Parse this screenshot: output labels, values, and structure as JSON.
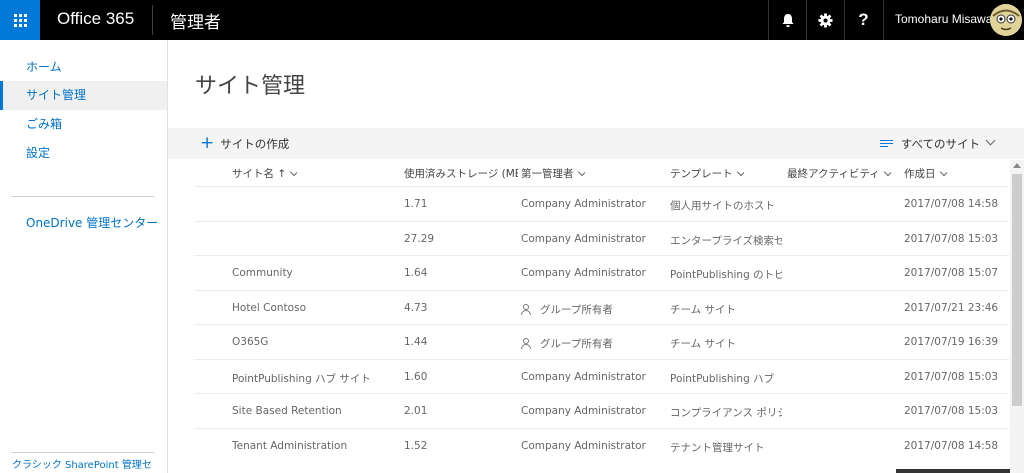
{
  "header": {
    "brand": "Office 365",
    "app_name": "管理者",
    "help_label": "?",
    "user_name": "Tomoharu Misawa"
  },
  "nav": {
    "items": [
      {
        "label": "ホーム"
      },
      {
        "label": "サイト管理"
      },
      {
        "label": "ごみ箱"
      },
      {
        "label": "設定"
      }
    ],
    "onedrive": "OneDrive 管理センター",
    "classic": "クラシック SharePoint 管理セ"
  },
  "main": {
    "title": "サイト管理",
    "create_label": "サイトの作成",
    "view_label": "すべてのサイト"
  },
  "table": {
    "columns": {
      "name": "サイト名 ↑",
      "storage": "使用済みストレージ (MB)",
      "admin": "第一管理者",
      "template": "テンプレート",
      "activity": "最終アクティビティ",
      "created": "作成日"
    },
    "rows": [
      {
        "name": "",
        "storage": "1.71",
        "admin": "Company Administrator",
        "admin_is_group": false,
        "template": "個人用サイトのホスト",
        "created": "2017/07/08 14:58"
      },
      {
        "name": "",
        "storage": "27.29",
        "admin": "Company Administrator",
        "admin_is_group": false,
        "template": "エンタープライズ検索セン",
        "created": "2017/07/08 15:03"
      },
      {
        "name": "Community",
        "storage": "1.64",
        "admin": "Company Administrator",
        "admin_is_group": false,
        "template": "PointPublishing のトピック",
        "created": "2017/07/08 15:07"
      },
      {
        "name": "Hotel Contoso",
        "storage": "4.73",
        "admin": "グループ所有者",
        "admin_is_group": true,
        "template": "チーム サイト",
        "created": "2017/07/21 23:46"
      },
      {
        "name": "O365G",
        "storage": "1.44",
        "admin": "グループ所有者",
        "admin_is_group": true,
        "template": "チーム サイト",
        "created": "2017/07/19 16:39"
      },
      {
        "name": "PointPublishing ハブ サイト",
        "storage": "1.60",
        "admin": "Company Administrator",
        "admin_is_group": false,
        "template": "PointPublishing ハブ",
        "created": "2017/07/08 15:03"
      },
      {
        "name": "Site Based Retention",
        "storage": "2.01",
        "admin": "Company Administrator",
        "admin_is_group": false,
        "template": "コンプライアンス ポリシー",
        "created": "2017/07/08 15:03"
      },
      {
        "name": "Tenant Administration",
        "storage": "1.52",
        "admin": "Company Administrator",
        "admin_is_group": false,
        "template": "テナント管理サイト",
        "created": "2017/07/08 14:58"
      }
    ]
  },
  "colors": {
    "accent": "#0078d7",
    "topbar": "#000000",
    "link": "#0072c6"
  }
}
